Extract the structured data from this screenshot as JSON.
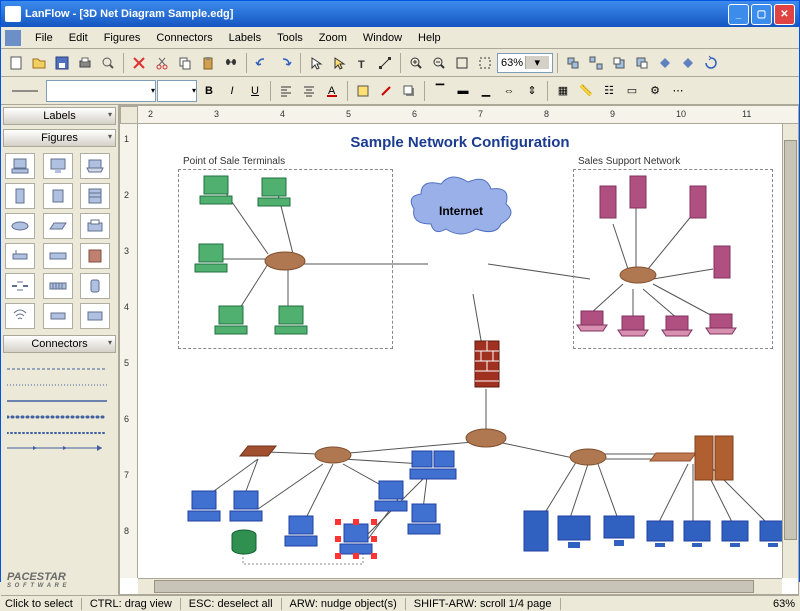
{
  "title": "LanFlow - [3D Net Diagram Sample.edg]",
  "menu": [
    "File",
    "Edit",
    "Figures",
    "Connectors",
    "Labels",
    "Tools",
    "Zoom",
    "Window",
    "Help"
  ],
  "zoom": "63%",
  "sidebar": {
    "labels_panel": "Labels",
    "figures_panel": "Figures",
    "connectors_panel": "Connectors"
  },
  "footer_logo": "PACESTAR",
  "footer_sub": "S O F T W A R E",
  "diagram": {
    "title": "Sample Network Configuration",
    "group1": "Point of Sale Terminals",
    "group2": "Sales Support Network",
    "cloud": "Internet"
  },
  "ruler_h": [
    "2",
    "3",
    "4",
    "5",
    "6",
    "7",
    "8",
    "9",
    "10",
    "11"
  ],
  "ruler_v": [
    "1",
    "2",
    "3",
    "4",
    "5",
    "6",
    "7",
    "8"
  ],
  "status": {
    "click": "Click to select",
    "ctrl": "CTRL: drag view",
    "esc": "ESC: deselect all",
    "arw": "ARW: nudge object(s)",
    "shift": "SHIFT-ARW: scroll 1/4 page",
    "zoom": "63%"
  }
}
